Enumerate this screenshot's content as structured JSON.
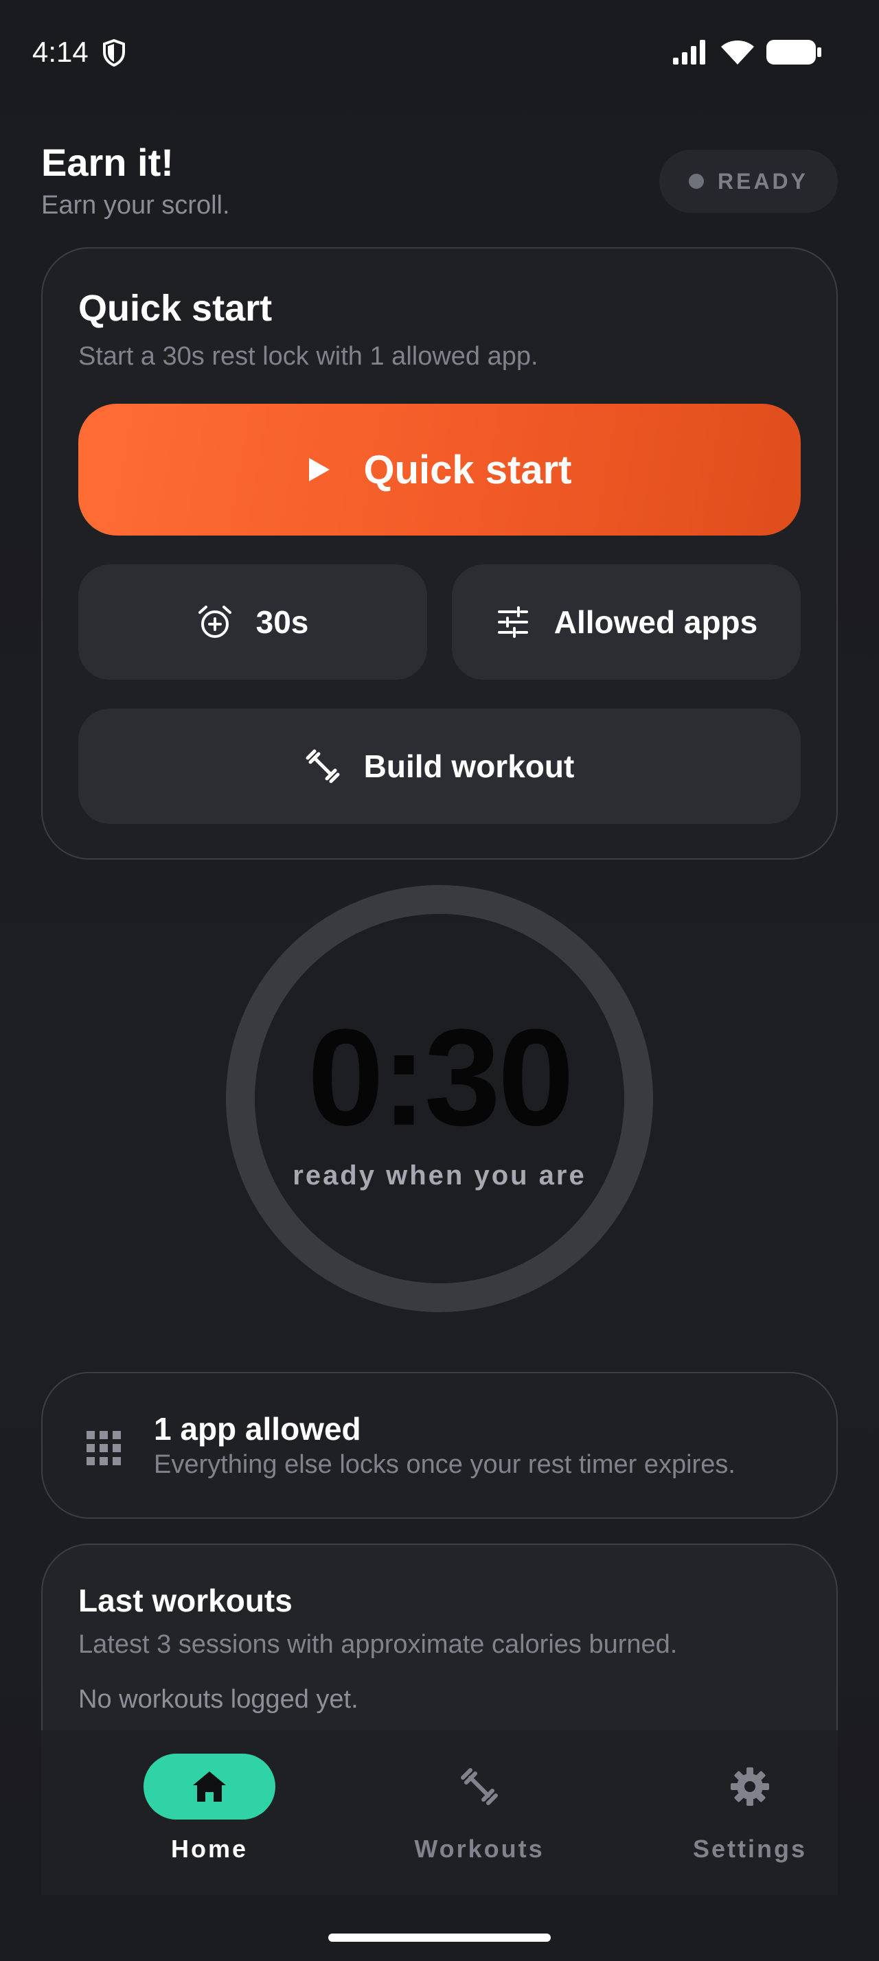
{
  "status_bar": {
    "time": "4:14",
    "icons": [
      "shield-icon",
      "signal-icon",
      "wifi-icon",
      "battery-icon"
    ]
  },
  "header": {
    "title": "Earn it!",
    "subtitle": "Earn your scroll.",
    "status_label": "READY"
  },
  "quick_start": {
    "title": "Quick start",
    "description": "Start a 30s rest lock with 1 allowed app.",
    "primary_label": "Quick start",
    "duration_label": "30s",
    "allowed_apps_label": "Allowed apps",
    "build_workout_label": "Build workout"
  },
  "timer": {
    "value": "0:30",
    "caption": "ready when you are"
  },
  "allowed_apps": {
    "title": "1 app allowed",
    "description": "Everything else locks once your rest timer expires."
  },
  "last_workouts": {
    "title": "Last workouts",
    "description": "Latest 3 sessions with approximate calories burned.",
    "empty_text": "No workouts logged yet."
  },
  "nav": {
    "items": [
      {
        "label": "Home",
        "icon": "home-icon",
        "active": true
      },
      {
        "label": "Workouts",
        "icon": "dumbbell-icon",
        "active": false
      },
      {
        "label": "Settings",
        "icon": "gear-icon",
        "active": false
      }
    ]
  },
  "colors": {
    "accent_orange": "#f25b27",
    "accent_green": "#2fd3a5",
    "background": "#1b1c20",
    "card": "#1f2024"
  }
}
